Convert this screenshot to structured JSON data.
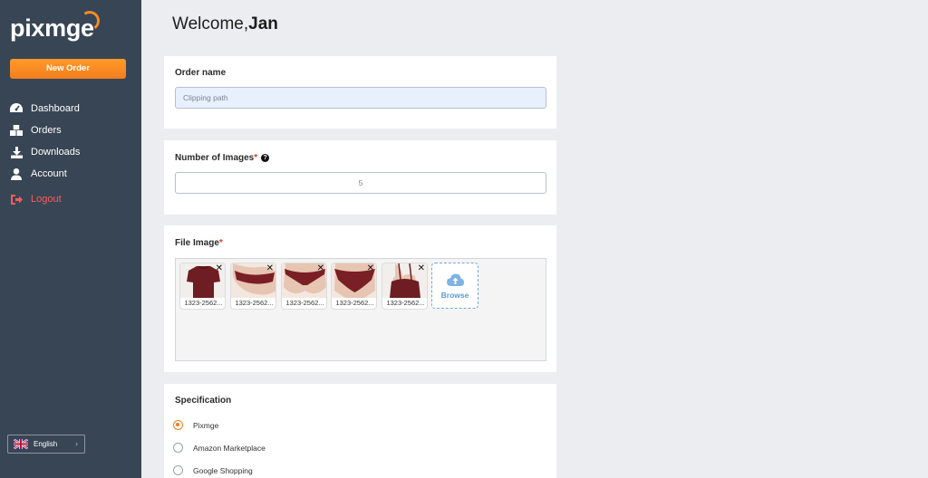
{
  "brand": {
    "logo_text": "pixmge",
    "accent": "#f47d1d"
  },
  "sidebar": {
    "new_order_label": "New Order",
    "items": [
      {
        "label": "Dashboard",
        "icon": "dashboard-icon"
      },
      {
        "label": "Orders",
        "icon": "boxes-icon"
      },
      {
        "label": "Downloads",
        "icon": "download-icon"
      },
      {
        "label": "Account",
        "icon": "user-icon"
      },
      {
        "label": "Logout",
        "icon": "logout-icon"
      }
    ],
    "language": {
      "label": "English",
      "icon": "uk-flag-icon"
    }
  },
  "header": {
    "welcome_prefix": "Welcome,",
    "user_name": "Jan"
  },
  "order_name": {
    "label": "Order name",
    "value": "Clipping path"
  },
  "images_count": {
    "label": "Number of Images",
    "required_mark": "*",
    "value": "5"
  },
  "file_image": {
    "label": "File Image",
    "required_mark": "*",
    "files": [
      {
        "name": "1323-2562..."
      },
      {
        "name": "1323-2562..."
      },
      {
        "name": "1323-2562..."
      },
      {
        "name": "1323-2562..."
      },
      {
        "name": "1323-2562..."
      }
    ],
    "browse_label": "Browse"
  },
  "specification": {
    "label": "Specification",
    "options": [
      {
        "label": "Pixmge",
        "selected": true
      },
      {
        "label": "Amazon Marketplace",
        "selected": false
      },
      {
        "label": "Google Shopping",
        "selected": false
      }
    ]
  }
}
